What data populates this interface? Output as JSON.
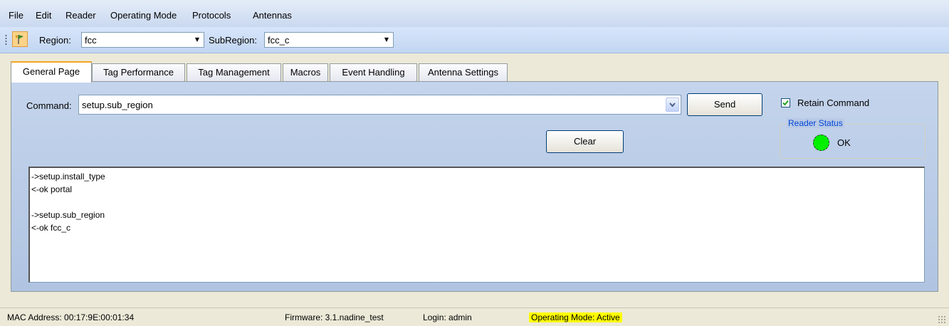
{
  "menu": {
    "items": [
      "File",
      "Edit",
      "Reader",
      "Operating Mode",
      "Protocols",
      "Antennas"
    ]
  },
  "toolbar": {
    "region_label": "Region:",
    "region_value": "fcc",
    "subregion_label": "SubRegion:",
    "subregion_value": "fcc_c"
  },
  "tabs": [
    {
      "label": "General Page",
      "active": true
    },
    {
      "label": "Tag Performance",
      "active": false
    },
    {
      "label": "Tag Management",
      "active": false
    },
    {
      "label": "Macros",
      "active": false
    },
    {
      "label": "Event Handling",
      "active": false
    },
    {
      "label": "Antenna Settings",
      "active": false
    }
  ],
  "general": {
    "command_label": "Command:",
    "command_value": "setup.sub_region",
    "send_label": "Send",
    "clear_label": "Clear",
    "retain_label": "Retain Command",
    "retain_checked": true,
    "reader_status_title": "Reader Status",
    "reader_status_value": "OK",
    "reader_status_color": "#00f000",
    "log_lines": [
      "->setup.install_type",
      "<-ok portal",
      "",
      "->setup.sub_region",
      "<-ok fcc_c"
    ]
  },
  "status": {
    "mac": "MAC Address: 00:17:9E:00:01:34",
    "firmware": "Firmware: 3.1.nadine_test",
    "login": "Login: admin",
    "mode": "Operating Mode: Active",
    "mode_highlight": "#ffff00"
  }
}
